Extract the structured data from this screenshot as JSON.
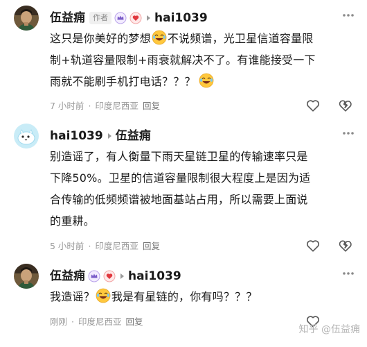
{
  "comments": [
    {
      "author": "伍益痈",
      "author_tag": "作者",
      "reply_to": "hai1039",
      "text_1": "这只是你美好的梦想",
      "text_2": "不说频谱，光卫星信道容量限",
      "text_3": "制+轨道容量限制+雨衰就解决不了。有谁能接受一下",
      "text_4": "雨就不能刷手机打电话？？？",
      "time": "7 小时前",
      "location": "印度尼西亚",
      "reply_label": "回复"
    },
    {
      "author": "hai1039",
      "reply_to": "伍益痈",
      "text_1": "别造谣了，有人衡量下雨天星链卫星的传输速率只是",
      "text_2": "下降50%。卫星的信道容量限制很大程度上是因为适",
      "text_3": "合传输的低频频谱被地面基站占用，所以需要上面说",
      "text_4": "的重耕。",
      "time": "5 小时前",
      "location": "印度尼西亚",
      "reply_label": "回复"
    },
    {
      "author": "伍益痈",
      "reply_to": "hai1039",
      "text_1": "我造谣？",
      "text_2": "我是有星链的，你有吗？？？",
      "time": "刚刚",
      "location": "印度尼西亚",
      "reply_label": "回复"
    }
  ],
  "watermark": "知乎 @伍益痈",
  "colors": {
    "text": "#1a1a1a",
    "meta": "#999999",
    "icon": "#5a5a5a",
    "badge_purple": "#7a5cc8",
    "badge_red": "#e0383e"
  },
  "icons": [
    "more-icon",
    "like-icon",
    "dislike-icon",
    "laughing-emoji",
    "crown-badge",
    "heart-badge"
  ]
}
